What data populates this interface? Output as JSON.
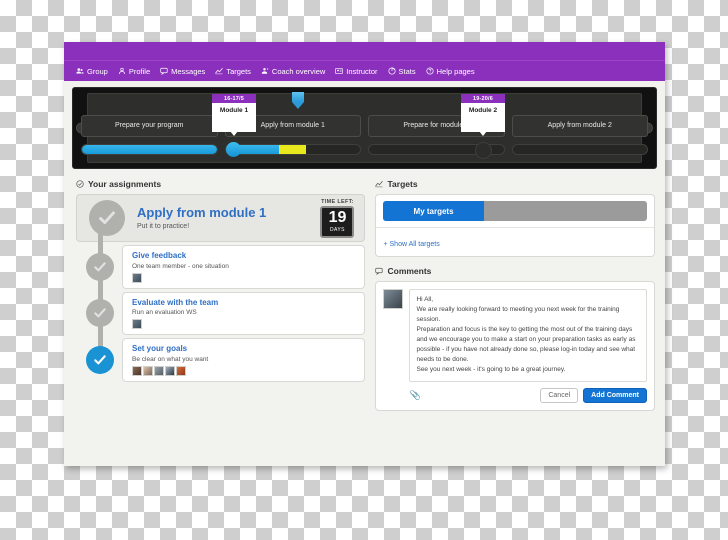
{
  "nav": {
    "items": [
      {
        "label": "Group",
        "icon": "group-icon"
      },
      {
        "label": "Profile",
        "icon": "profile-icon"
      },
      {
        "label": "Messages",
        "icon": "messages-icon"
      },
      {
        "label": "Targets",
        "icon": "targets-chart-icon"
      },
      {
        "label": "Coach overview",
        "icon": "coach-icon"
      },
      {
        "label": "Instructor",
        "icon": "instructor-icon"
      },
      {
        "label": "Stats",
        "icon": "stats-icon"
      },
      {
        "label": "Help pages",
        "icon": "help-icon"
      }
    ]
  },
  "timeline": {
    "blocks": [
      {
        "label": "Prepare your program"
      },
      {
        "label": "Apply from module 1"
      },
      {
        "label": "Prepare for module 2"
      },
      {
        "label": "Apply from module 2"
      }
    ],
    "bars": [
      {
        "blue_percent": 100,
        "yellow_percent": 0
      },
      {
        "blue_percent": 40,
        "yellow_percent": 20
      },
      {
        "blue_percent": 0,
        "yellow_percent": 0
      },
      {
        "blue_percent": 0,
        "yellow_percent": 0
      }
    ],
    "milestones": [
      {
        "date": "16-17/5",
        "name": "Module 1",
        "state": "active"
      },
      {
        "date": "19-20/6",
        "name": "Module 2",
        "state": "inactive"
      }
    ]
  },
  "assignments": {
    "section_label": "Your assignments",
    "current": {
      "title": "Apply from module 1",
      "subtitle": "Put it to practice!",
      "time_left_label": "TIME LEFT:",
      "time_left_value": "19",
      "time_left_unit": "DAYS"
    },
    "steps": [
      {
        "title": "Give feedback",
        "subtitle": "One team member - one situation",
        "state": "pending",
        "avatar_count": 1
      },
      {
        "title": "Evaluate with the team",
        "subtitle": "Run an evaluation WS",
        "state": "pending",
        "avatar_count": 1
      },
      {
        "title": "Set your goals",
        "subtitle": "Be clear on what you want",
        "state": "done",
        "avatar_count": 5
      }
    ]
  },
  "targets": {
    "section_label": "Targets",
    "my_targets_label": "My targets",
    "show_all_label": "+ Show All targets",
    "progress_percent": 38
  },
  "comments": {
    "section_label": "Comments",
    "body_lines": [
      "Hi All,",
      "We are really looking forward to meeting you next week for the training session.",
      "Preparation and focus is the key to getting the most out of the training days and we encourage you to make a start on your preparation tasks as early as possible - if you have not already done so, please log-in today and see what needs to be done.",
      "See you next week - it's going to be a great journey."
    ],
    "cancel_label": "Cancel",
    "add_label": "Add Comment",
    "attach_icon": "paperclip-icon"
  },
  "colors": {
    "brand_purple": "#8b2fbd",
    "accent_blue": "#1374d4",
    "progress_blue": "#1a93d4",
    "progress_yellow": "#e8e81d",
    "muted_grey": "#b0b0ad"
  }
}
